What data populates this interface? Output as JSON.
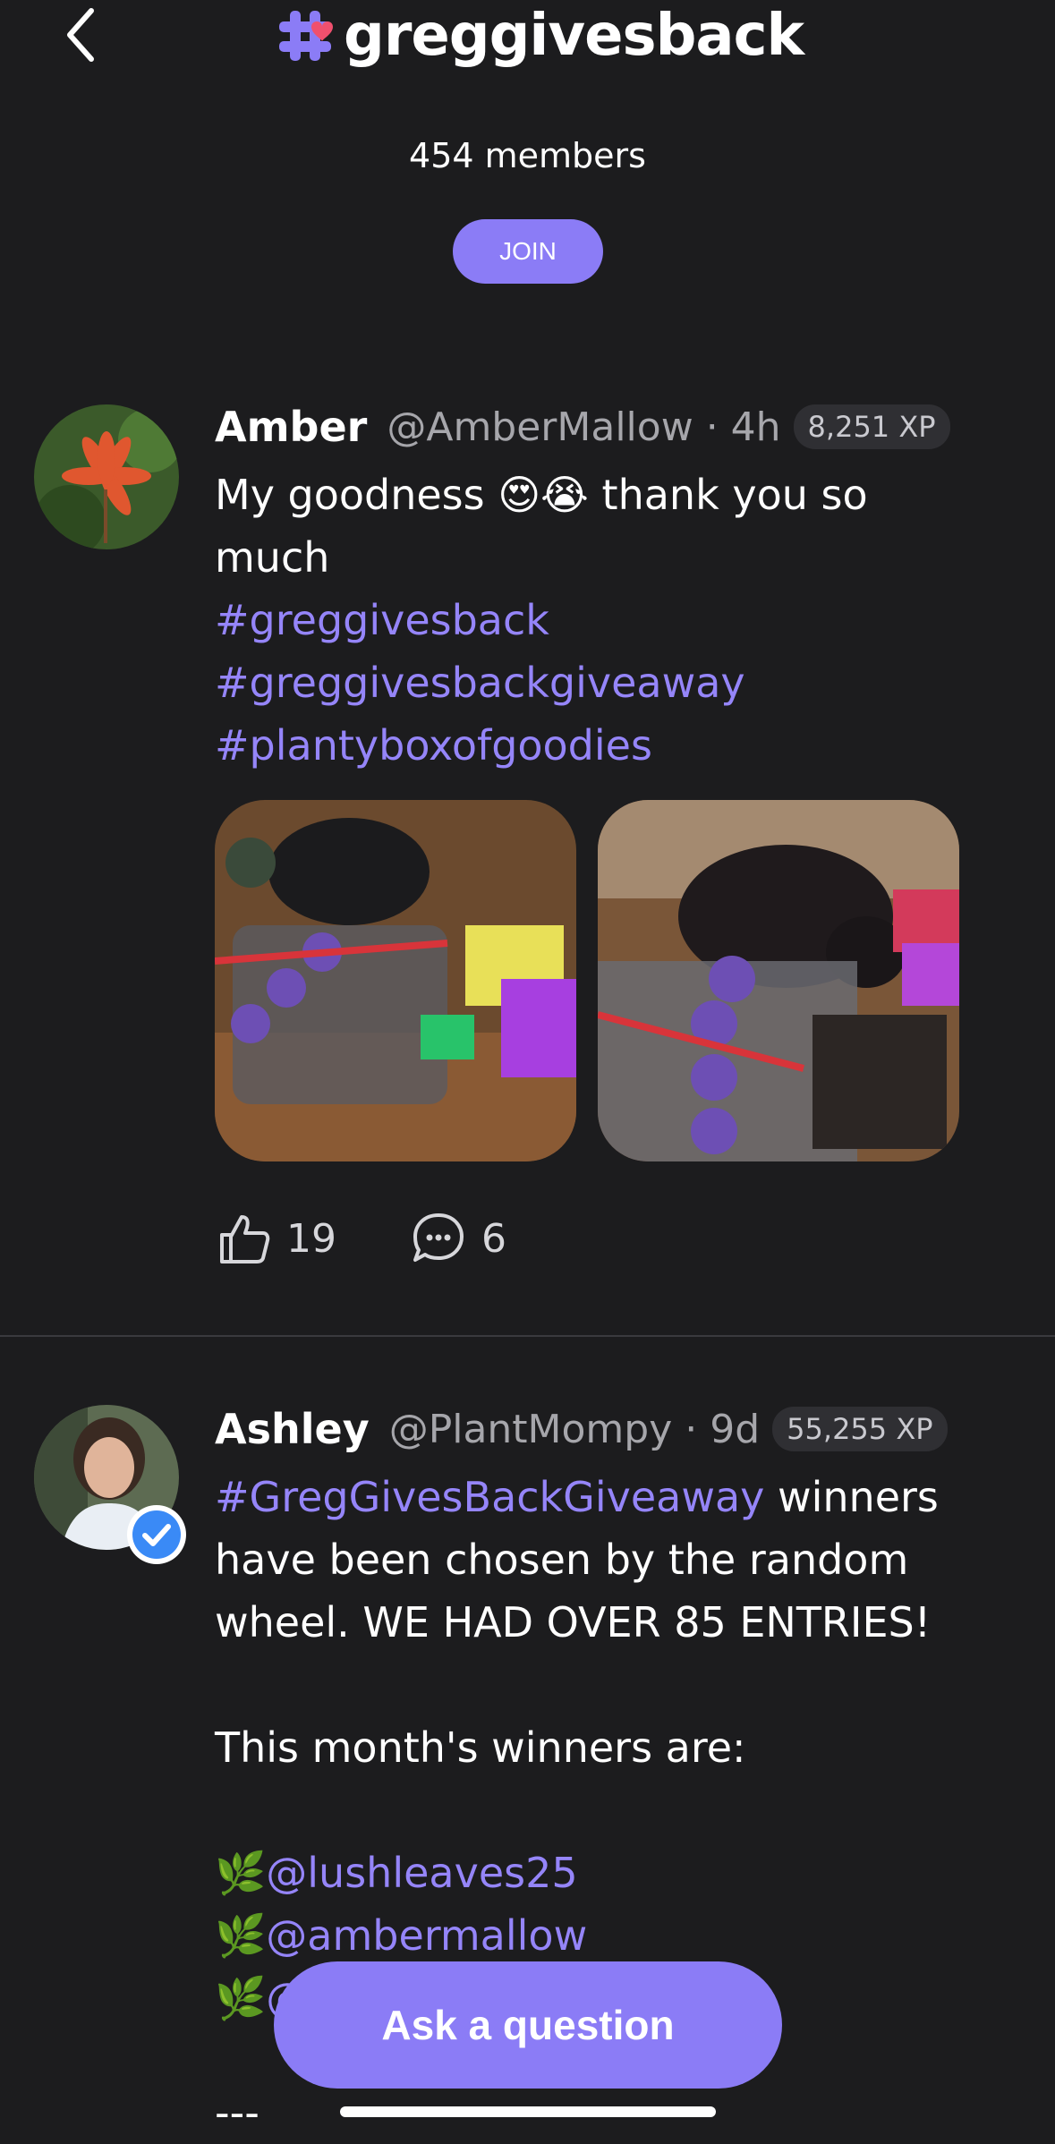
{
  "header": {
    "back_icon": "chevron-left-icon",
    "community_icon": "hash-heart-icon",
    "title": "greggivesback",
    "members": "454 members",
    "join_label": "JOIN"
  },
  "colors": {
    "background": "#1c1c1e",
    "accent": "#8b7cf6",
    "hashtag": "#9585f9",
    "muted": "#a6a6ab"
  },
  "posts": [
    {
      "name": "Amber",
      "handle": "@AmberMallow",
      "time": "· 4h",
      "xp": "8,251 XP",
      "text_line1": "My goodness 😍😭 thank you so",
      "text_line2": "much",
      "tags": [
        "#greggivesback",
        "#greggivesbackgiveaway",
        "#plantyboxofgoodies"
      ],
      "likes": "19",
      "comments": "6"
    },
    {
      "name": "Ashley",
      "handle": "@PlantMompy",
      "time": "· 9d",
      "xp": "55,255 XP",
      "lead_tag": "#GregGivesBackGiveaway",
      "line1_rest": " winners",
      "line2": "have been chosen by the random",
      "line3": "wheel.  WE HAD OVER 85 ENTRIES!",
      "line4": "This month's winners are:",
      "winners": [
        "🌿@lushleaves25",
        "🌿@ambermallow",
        "🌿@"
      ],
      "footer": "---"
    }
  ],
  "ask_label": "Ask a question"
}
